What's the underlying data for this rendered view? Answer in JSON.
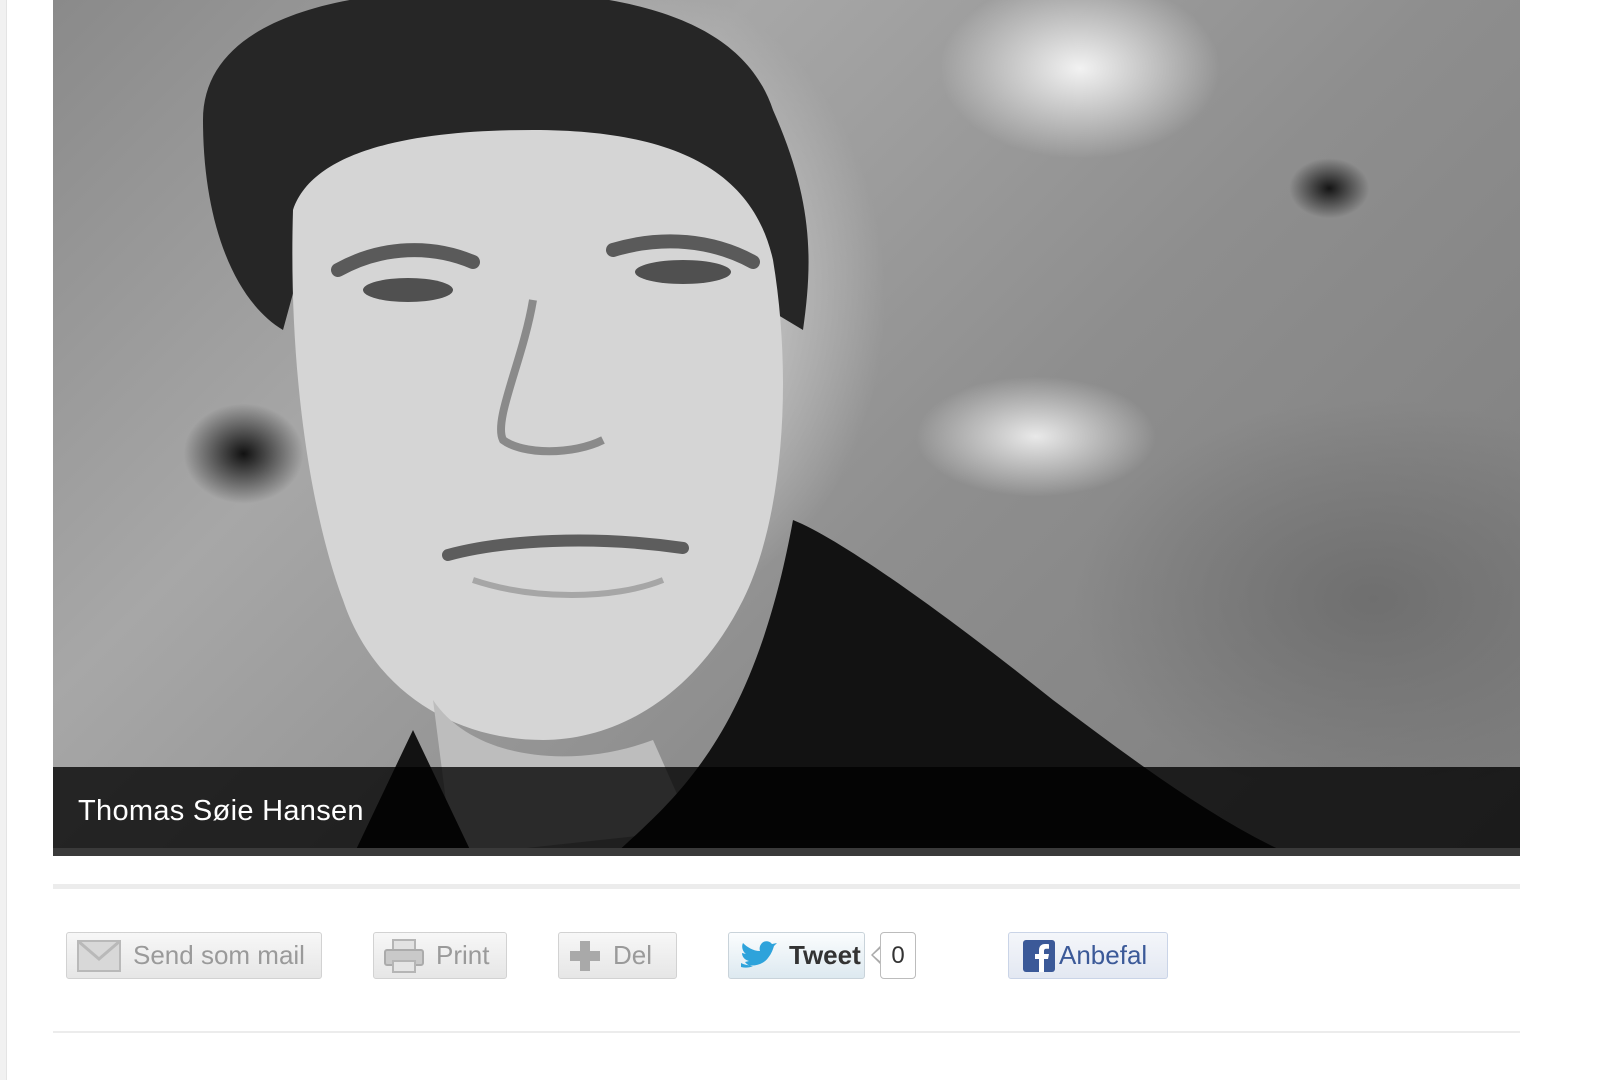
{
  "photo": {
    "caption": "Thomas Søie Hansen"
  },
  "share_bar": {
    "mail_label": "Send som mail",
    "print_label": "Print",
    "share_label": "Del",
    "tweet_label": "Tweet",
    "tweet_count": "0",
    "facebook_label": "Anbefal"
  },
  "icons": {
    "mail": "envelope-icon",
    "print": "printer-icon",
    "share": "plus-icon",
    "tweet": "twitter-bird-icon",
    "facebook": "facebook-icon"
  },
  "colors": {
    "caption_bg": "#000000",
    "facebook_blue": "#3b5998",
    "twitter_blue": "#2ea3db",
    "button_text_gray": "#9a9a9a"
  }
}
